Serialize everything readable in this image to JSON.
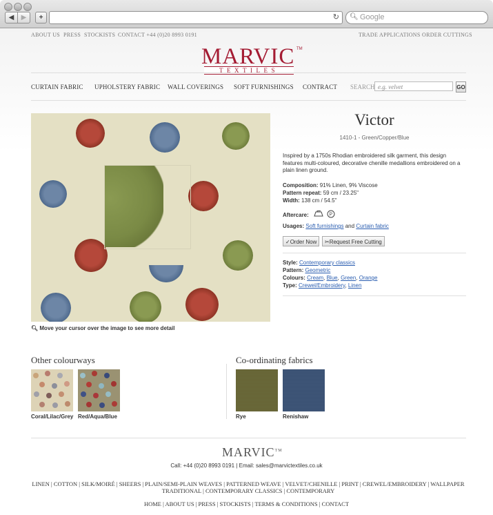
{
  "browser": {
    "back": "◀",
    "forward": "▶",
    "new_tab": "+",
    "reload_icon": "reload-icon",
    "search_placeholder": "Google"
  },
  "utility_nav": {
    "left": [
      "ABOUT US",
      "PRESS",
      "STOCKISTS",
      "CONTACT +44 (0)20 8993 0191"
    ],
    "right": [
      "TRADE APPLICATIONS",
      "ORDER CUTTINGS"
    ]
  },
  "logo": {
    "main": "MARVIC",
    "tm": "TM",
    "sub": "TEXTILES"
  },
  "main_nav": [
    "CURTAIN FABRIC",
    "UPHOLSTERY FABRIC",
    "WALL COVERINGS",
    "SOFT FURNISHINGS",
    "CONTRACT"
  ],
  "search": {
    "label": "SEARCH",
    "placeholder": "e.g. velvet",
    "button": "GO"
  },
  "product": {
    "zoom_hint": "Move your cursor over the image to see more detail",
    "title": "Victor",
    "code": "1410-1 - Green/Copper/Blue",
    "description": "Inspired by a 1750s Rhodian embroidered silk garment, this design features multi-coloured, decorative chenille medallions embroidered on a plain linen ground.",
    "composition_label": "Composition:",
    "composition": "91% Linen, 9% Viscose",
    "pattern_repeat_label": "Pattern repeat:",
    "pattern_repeat": "59 cm / 23.25\"",
    "width_label": "Width:",
    "width": "138 cm / 54.5\"",
    "aftercare_label": "Aftercare:",
    "usages_label": "Usages:",
    "usage_1": "Soft furnishings",
    "usage_and": "and",
    "usage_2": "Curtain fabric",
    "order_now": "Order Now",
    "request_cutting": "Request Free Cutting",
    "style_label": "Style:",
    "style": "Contemporary classics",
    "pattern_label": "Pattern:",
    "pattern": "Geometric",
    "colours_label": "Colours:",
    "colours": [
      "Cream",
      "Blue",
      "Green",
      "Orange"
    ],
    "type_label": "Type:",
    "types": [
      "Crewel/Embroidery",
      "Linen"
    ],
    "colors": {
      "red": "#a83d2b",
      "blue": "#5a7599",
      "green": "#7a8a45",
      "ground": "#e4e0c4"
    }
  },
  "other_colourways": {
    "title": "Other colourways",
    "items": [
      "Coral/Lilac/Grey",
      "Red/Aqua/Blue"
    ]
  },
  "coordinating": {
    "title": "Co-ordinating fabrics",
    "items": [
      "Rye",
      "Renishaw"
    ],
    "colors": [
      "#6b6a3a",
      "#3e5478"
    ]
  },
  "footer": {
    "logo": "MARVIC",
    "tm": "TM",
    "contact": "Call: +44 (0)20 8993 0191 | Email: sales@marvictextiles.co.uk",
    "categories_line1": "LINEN | COTTON | SILK/MOIRÉ | SHEERS | PLAIN/SEMI-PLAIN WEAVES | PATTERNED WEAVE | VELVET/CHENILLE | PRINT | CREWEL/EMBROIDERY | WALLPAPER",
    "categories_line2": "TRADITIONAL | CONTEMPORARY CLASSICS | CONTEMPORARY",
    "nav": "HOME | ABOUT US | PRESS | STOCKISTS | TERMS & CONDITIONS | CONTACT"
  }
}
